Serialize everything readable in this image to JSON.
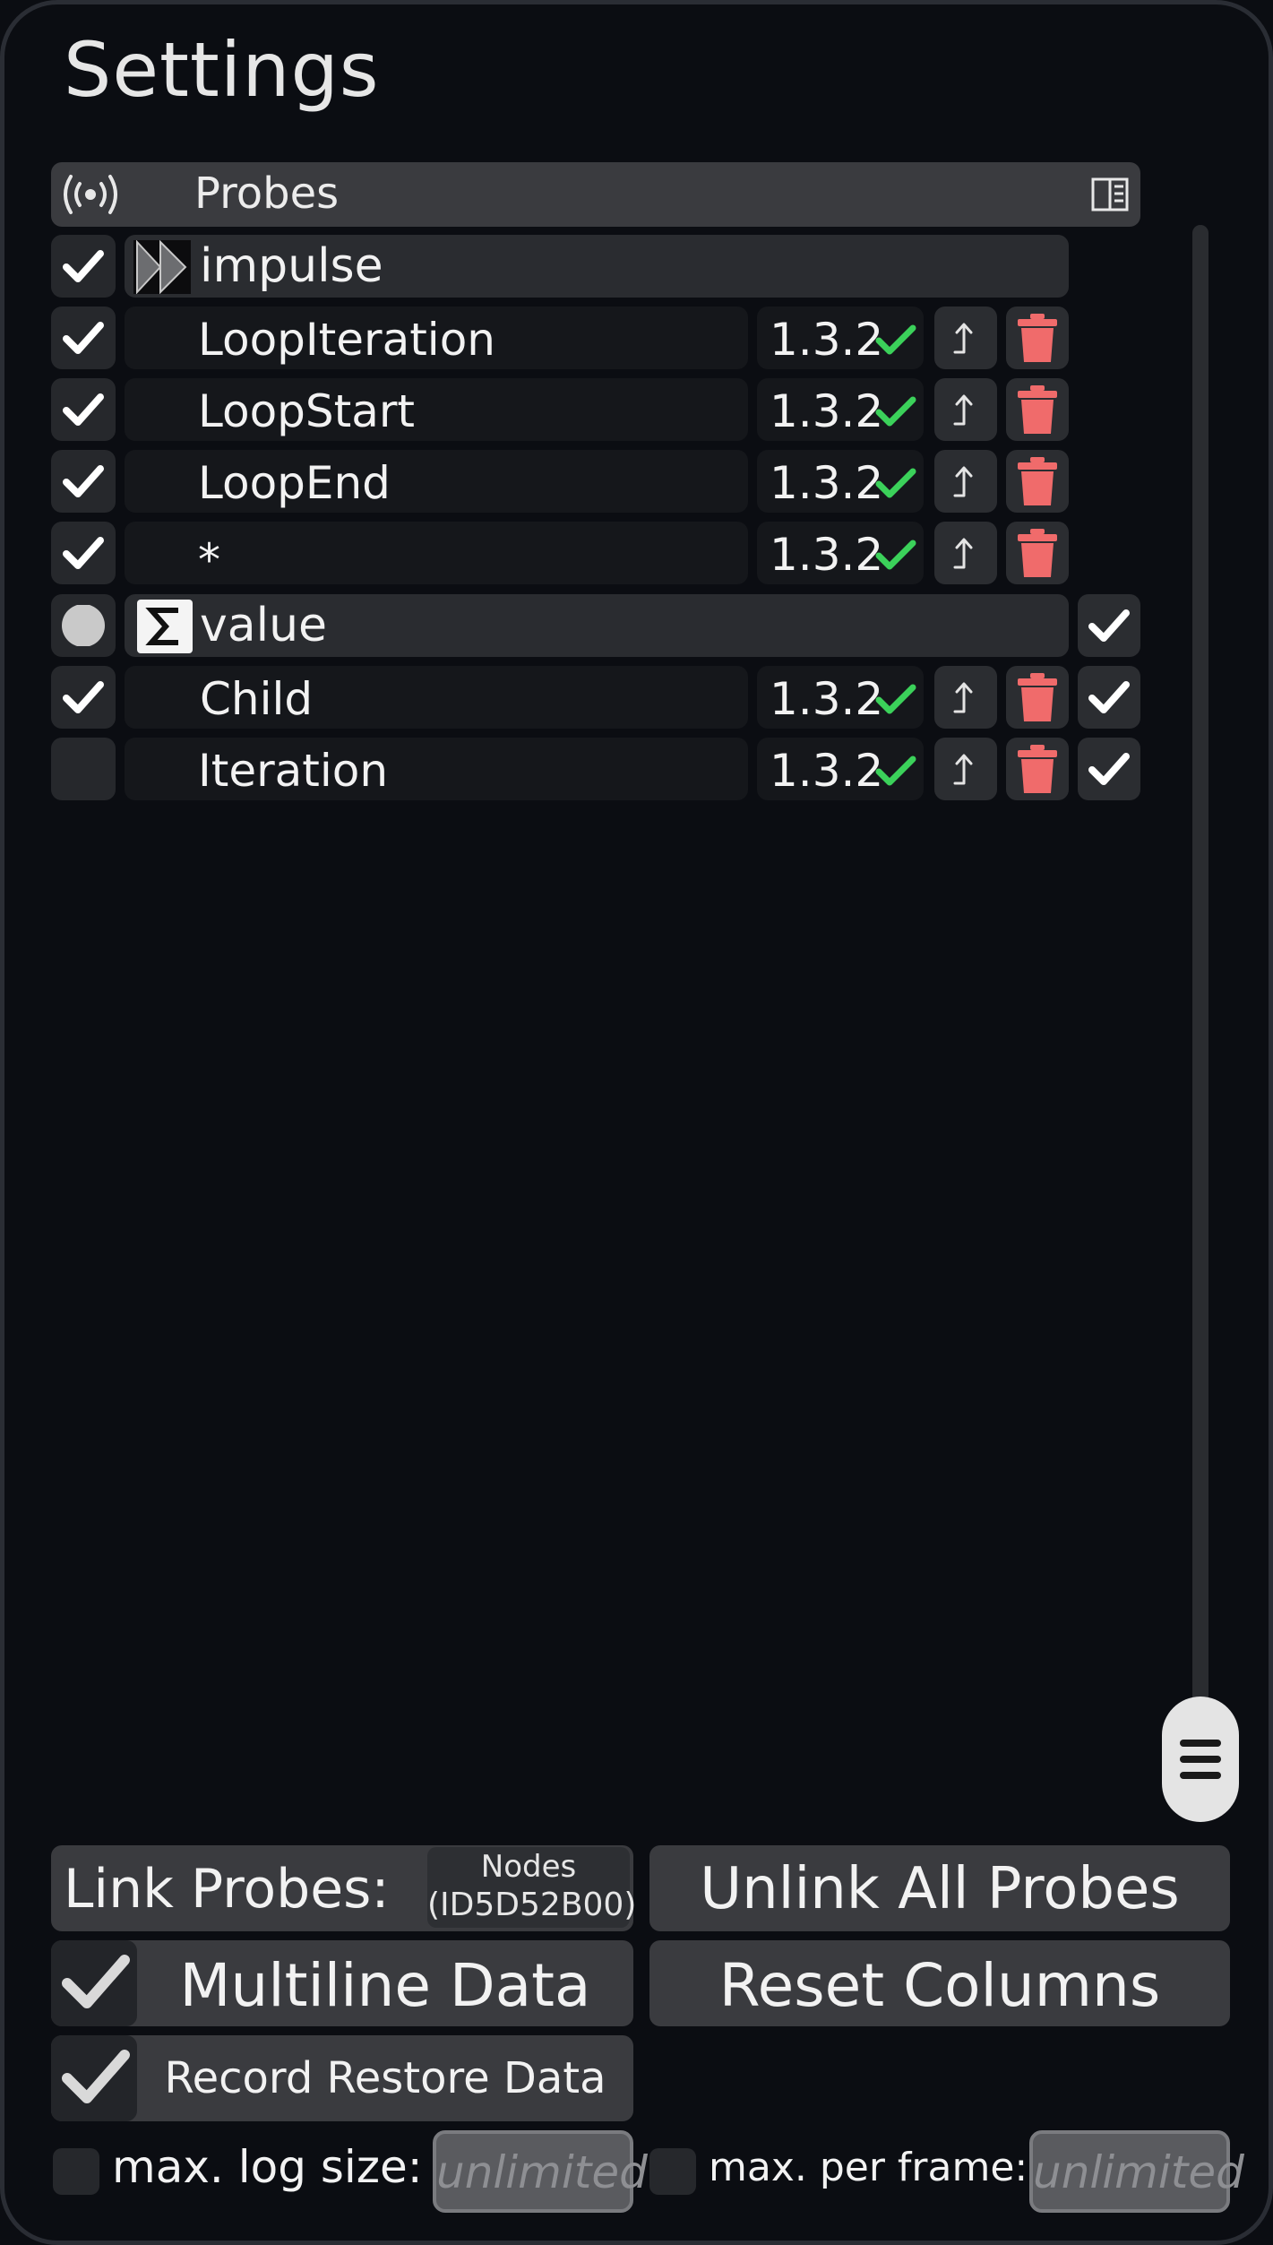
{
  "title": "Settings",
  "header": {
    "label": "Probes"
  },
  "groups": {
    "impulse": {
      "label": "impulse"
    },
    "value": {
      "label": "value"
    }
  },
  "rows": [
    {
      "name": "LoopIteration",
      "version": "1.3.2"
    },
    {
      "name": "LoopStart",
      "version": "1.3.2"
    },
    {
      "name": "LoopEnd",
      "version": "1.3.2"
    },
    {
      "name": "*",
      "version": "1.3.2"
    },
    {
      "name": "Child",
      "version": "1.3.2"
    },
    {
      "name": "Iteration",
      "version": "1.3.2"
    }
  ],
  "buttons": {
    "link_probes": "Link Probes:",
    "nodes_line1": "Nodes",
    "nodes_line2": "(ID5D52B00)",
    "unlink_all": "Unlink All Probes",
    "multiline": "Multiline Data",
    "reset_columns": "Reset Columns",
    "record_restore": "Record Restore Data"
  },
  "limits": {
    "max_log_label": "max. log size:",
    "max_log_value": "unlimited",
    "max_frame_label": "max. per frame:",
    "max_frame_value": "unlimited"
  },
  "colors": {
    "delete": "#f06b6b",
    "ok": "#3bd15a",
    "panel": "#0b0d12"
  },
  "icons": [
    "probe-icon",
    "panel-toggle-icon",
    "impulse-icon",
    "sigma-icon",
    "check-icon",
    "jump-icon",
    "trash-icon",
    "hamburger-icon"
  ]
}
